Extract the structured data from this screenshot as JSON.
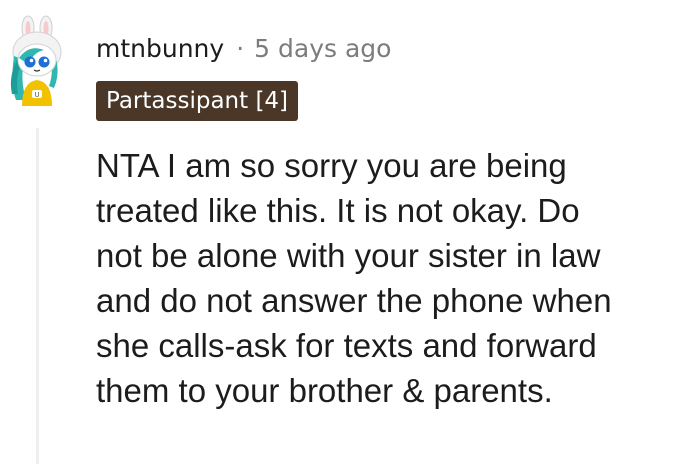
{
  "comment": {
    "username": "mtnbunny",
    "separator": "·",
    "timestamp": "5 days ago",
    "flair": "Partassipant [4]",
    "body_lines": [
      "NTA I am so sorry you are being",
      "treated like this. It is not okay. Do",
      "not be alone with your sister in law",
      "and do not answer the phone when",
      "she calls-ask for texts and forward",
      "them to your brother & parents."
    ],
    "avatar_icon": "bunny-avatar-icon"
  },
  "colors": {
    "flair_background": "#4a3728",
    "flair_text": "#ffffff",
    "username": "#1c1c1c",
    "meta": "#7c7c7c",
    "thread_line": "#edeff1"
  }
}
